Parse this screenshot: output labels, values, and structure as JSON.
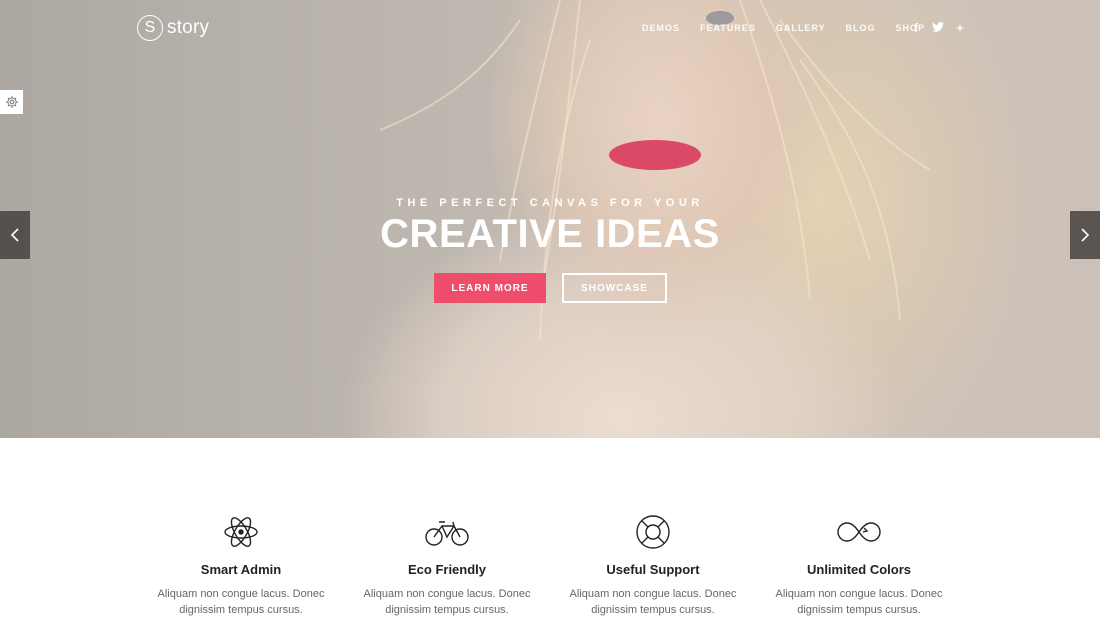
{
  "brand": {
    "mark": "S",
    "name": "story"
  },
  "nav": {
    "items": [
      "DEMOS",
      "FEATURES",
      "GALLERY",
      "BLOG",
      "SHOP"
    ],
    "social_icons": [
      "facebook-icon",
      "twitter-icon",
      "plus-icon"
    ]
  },
  "hero": {
    "tagline": "THE PERFECT CANVAS FOR YOUR",
    "headline": "CREATIVE IDEAS",
    "primary_button": "LEARN MORE",
    "secondary_button": "SHOWCASE"
  },
  "features": [
    {
      "icon": "atom-icon",
      "title": "Smart Admin",
      "desc_line1": "Aliquam non congue lacus. Donec",
      "desc_line2": "dignissim tempus cursus."
    },
    {
      "icon": "bicycle-icon",
      "title": "Eco Friendly",
      "desc_line1": "Aliquam non congue lacus. Donec",
      "desc_line2": "dignissim tempus cursus."
    },
    {
      "icon": "lifebuoy-icon",
      "title": "Useful Support",
      "desc_line1": "Aliquam non congue lacus. Donec",
      "desc_line2": "dignissim tempus cursus."
    },
    {
      "icon": "infinity-icon",
      "title": "Unlimited Colors",
      "desc_line1": "Aliquam non congue lacus. Donec",
      "desc_line2": "dignissim tempus cursus."
    }
  ],
  "colors": {
    "accent": "#ee4d6b",
    "heading": "#222222",
    "body_text": "#666666"
  }
}
